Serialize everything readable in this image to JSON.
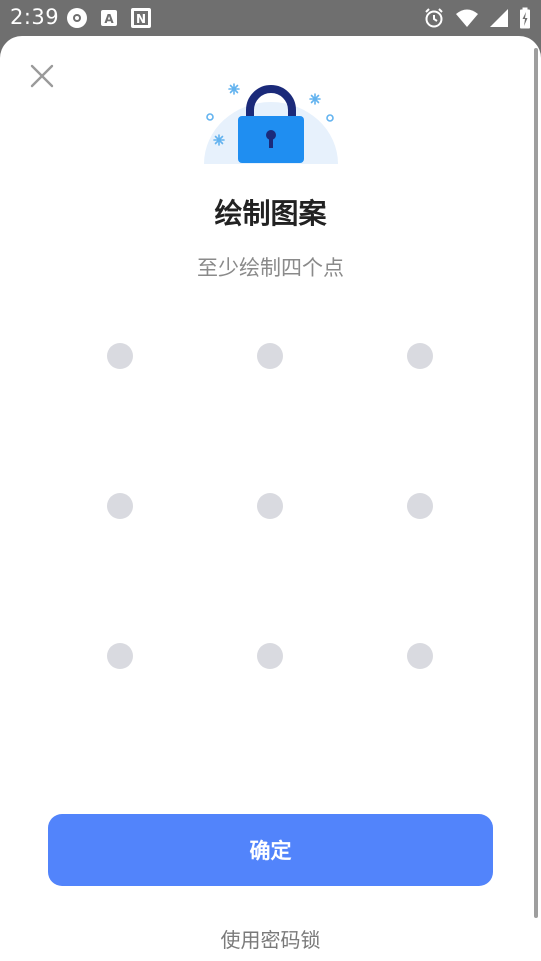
{
  "status_bar": {
    "time": "2:39",
    "left_icons": [
      "settings-badge-icon",
      "app-a-icon",
      "notion-n-icon"
    ],
    "right_icons": [
      "alarm-icon",
      "wifi-icon",
      "signal-icon",
      "battery-icon"
    ]
  },
  "sheet": {
    "close_icon": "close-icon",
    "hero_icon": "padlock-illustration-icon",
    "title": "绘制图案",
    "subtitle": "至少绘制四个点",
    "pattern_dots": 9,
    "confirm_label": "确定",
    "alt_label": "使用密码锁"
  },
  "colors": {
    "accent": "#5284fb",
    "dot": "#d9dae0",
    "lock_body": "#1f8ef1",
    "lock_shackle": "#1b2a7a"
  }
}
